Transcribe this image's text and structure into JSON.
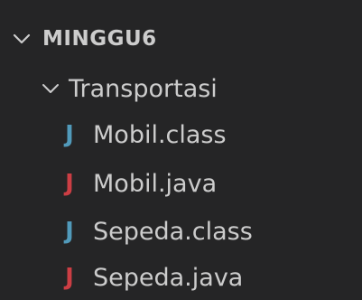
{
  "explorer": {
    "root": {
      "label": "MINGGU6",
      "icon": "chevron-down-icon"
    },
    "folder": {
      "label": "Transportasi",
      "icon": "chevron-down-icon"
    },
    "files": [
      {
        "label": "Mobil.class",
        "icon": "java-class-icon",
        "glyph": "J",
        "color": "#519aba"
      },
      {
        "label": "Mobil.java",
        "icon": "java-file-icon",
        "glyph": "J",
        "color": "#cc3e44"
      },
      {
        "label": "Sepeda.class",
        "icon": "java-class-icon",
        "glyph": "J",
        "color": "#519aba"
      },
      {
        "label": "Sepeda.java",
        "icon": "java-file-icon",
        "glyph": "J",
        "color": "#cc3e44"
      }
    ]
  },
  "colors": {
    "background": "#252526",
    "text": "#cccccc"
  }
}
